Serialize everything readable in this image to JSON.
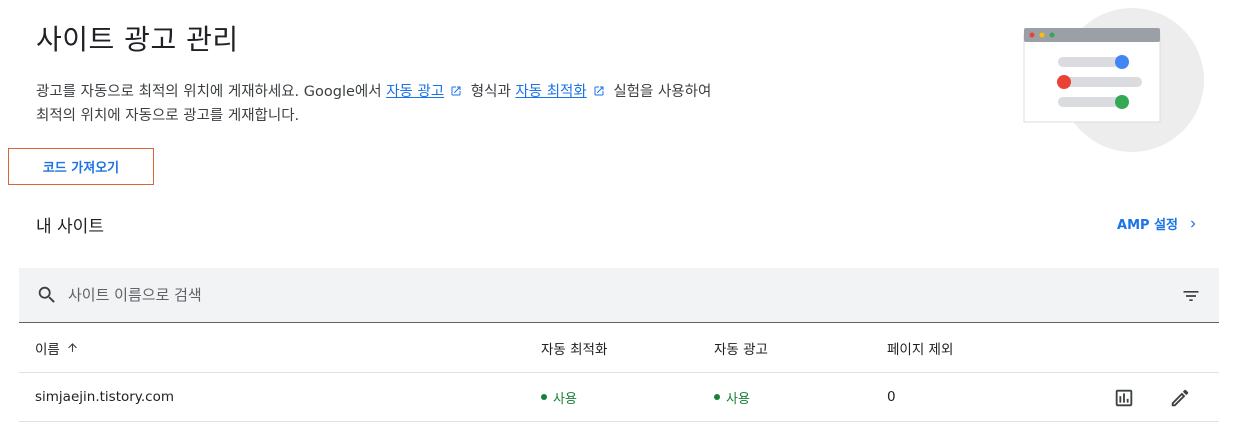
{
  "header": {
    "title": "사이트 광고 관리",
    "description_part1": "광고를 자동으로 최적의 위치에 게재하세요. Google에서 ",
    "link_auto_ads": "자동 광고",
    "description_part2": " 형식과 ",
    "link_auto_optimize": "자동 최적화",
    "description_part3": " 실험을 사용하여",
    "description_line2": "최적의 위치에 자동으로 광고를 게재합니다.",
    "import_button": "코드 가져오기"
  },
  "sites": {
    "section_title": "내 사이트",
    "amp_link": "AMP 설정",
    "search_placeholder": "사이트 이름으로 검색",
    "columns": {
      "name": "이름",
      "auto_optimize": "자동 최적화",
      "auto_ads": "자동 광고",
      "page_exclusions": "페이지 제외"
    },
    "rows": [
      {
        "name": "simjaejin.tistory.com",
        "auto_optimize": "사용",
        "auto_ads": "사용",
        "page_exclusions": "0"
      }
    ]
  },
  "colors": {
    "accent": "#1a73e8",
    "status_green": "#188038",
    "button_outline": "#d9643a",
    "search_bg": "#f1f3f4"
  },
  "icons": [
    "external-link-icon",
    "chevron-right-icon",
    "search-icon",
    "filter-icon",
    "arrow-up-icon",
    "report-icon",
    "edit-pencil-icon"
  ]
}
